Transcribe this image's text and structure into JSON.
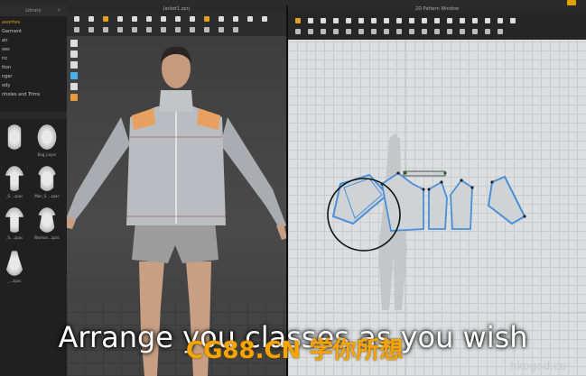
{
  "library": {
    "title": "Library",
    "tree": [
      "Favorites",
      "Garment",
      "Hair",
      "Shoes",
      "Fabric",
      "Button",
      "Hanger",
      "Body",
      "Buttonholes and Trims"
    ],
    "tree_display": [
      "avorites",
      "Garment",
      "air",
      "oes",
      "ric",
      "tton",
      "nger",
      "ody",
      "nholes and Trims"
    ],
    "thumbs": [
      "",
      "Bag Layer",
      "",
      "",
      "",
      "",
      "",
      "",
      ""
    ],
    "thumb_captions": [
      "",
      "Bag_Layer",
      "_S....zpac",
      "Man_S....zpac",
      "_S....zpac",
      "Woman...zpac",
      "_...zpac",
      "",
      ""
    ]
  },
  "viewport": {
    "title": "Jacket1.zprj"
  },
  "pattern_window": {
    "title": "2D Pattern Window"
  },
  "caption": "Arrange you classes as you wish",
  "watermark_cn": "CG88.CN 学你所想",
  "watermark_url": "hkogad.co",
  "colors": {
    "accent": "#e0a020",
    "pattern_outline": "#4a90d9",
    "jacket": "#b9bcc0"
  }
}
